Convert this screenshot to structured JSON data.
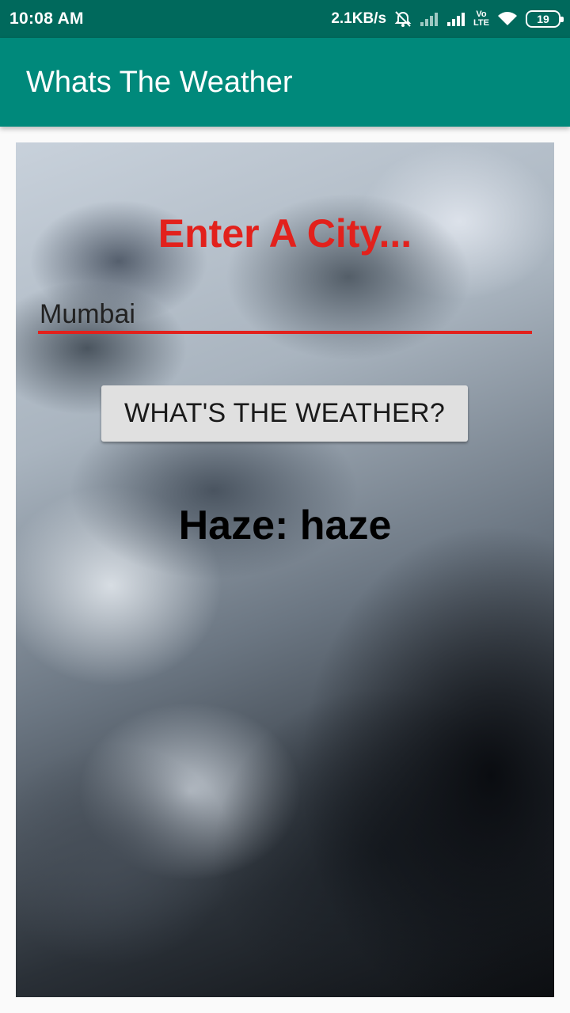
{
  "status_bar": {
    "time": "10:08 AM",
    "network_speed": "2.1KB/s",
    "icons": [
      "alarm-off-icon",
      "signal-weak-icon",
      "signal-strong-icon",
      "volte-icon",
      "wifi-icon",
      "battery-icon"
    ],
    "volte_line1": "Vo",
    "volte_line2": "LTE",
    "battery": "19"
  },
  "app_bar": {
    "title": "Whats The Weather",
    "color": "#00897b"
  },
  "main": {
    "heading": "Enter A City...",
    "heading_color": "#e2211c",
    "city_input_value": "Mumbai",
    "button_label": "WHAT'S THE WEATHER?",
    "result_text": "Haze: haze"
  }
}
